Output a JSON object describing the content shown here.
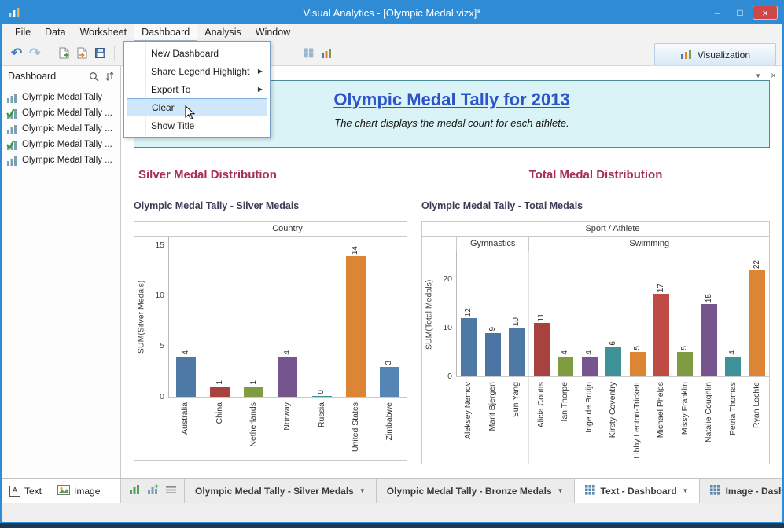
{
  "window": {
    "title": "Visual Analytics - [Olympic Medal.vizx]*",
    "controls": {
      "minimize": "–",
      "maximize": "□",
      "close": "×"
    }
  },
  "menu_bar": {
    "items": [
      {
        "label": "File",
        "open": false
      },
      {
        "label": "Data",
        "open": false
      },
      {
        "label": "Worksheet",
        "open": false
      },
      {
        "label": "Dashboard",
        "open": true
      },
      {
        "label": "Analysis",
        "open": false
      },
      {
        "label": "Window",
        "open": false
      }
    ]
  },
  "dashboard_menu": {
    "items": [
      {
        "label": "New Dashboard",
        "submenu": false,
        "highlighted": false
      },
      {
        "label": "Share Legend Highlight",
        "submenu": true,
        "highlighted": false
      },
      {
        "label": "Export To",
        "submenu": true,
        "highlighted": false
      },
      {
        "label": "Clear",
        "submenu": false,
        "highlighted": true
      },
      {
        "label": "Show Title",
        "submenu": false,
        "highlighted": false
      }
    ]
  },
  "toolbar": {
    "visualization_label": "Visualization"
  },
  "panel": {
    "menu_glyph": "▼",
    "close_glyph": "×"
  },
  "glyphs": {
    "undo": "↶",
    "redo": "↷",
    "small_chevron": "▾",
    "dropdown_chevron": "▼",
    "submenu_arrow": "▶"
  },
  "sidebar": {
    "header": "Dashboard",
    "items": [
      {
        "label": "Olympic Medal Tally",
        "checked": false
      },
      {
        "label": "Olympic Medal Tally ...",
        "checked": true
      },
      {
        "label": "Olympic Medal Tally ...",
        "checked": false
      },
      {
        "label": "Olympic Medal Tally ...",
        "checked": true
      },
      {
        "label": "Olympic Medal Tally ...",
        "checked": false
      }
    ],
    "footer": {
      "text_label": "Text",
      "text_icon_glyph": "A",
      "image_label": "Image"
    }
  },
  "banner": {
    "title": "Olympic Medal Tally for 2013",
    "subtitle": "The chart displays the medal count for each athlete."
  },
  "chart_data": [
    {
      "type": "bar",
      "section_heading": "Silver Medal Distribution",
      "title": "Olympic Medal Tally - Silver Medals",
      "column_header": "Country",
      "ylabel": "SUM(Silver Medals)",
      "yticks": [
        0,
        5,
        10,
        15
      ],
      "ylim": [
        0,
        16
      ],
      "grid": false,
      "categories": [
        "Australia",
        "China",
        "Netherlands",
        "Norway",
        "Russia",
        "United States",
        "Zimbabwe"
      ],
      "values": [
        4,
        1,
        1,
        4,
        0,
        14,
        3
      ],
      "colors": [
        "#4e79a7",
        "#a8423e",
        "#7f9c43",
        "#76558e",
        "#3d9397",
        "#db8535",
        "#5585b5"
      ],
      "groups": []
    },
    {
      "type": "bar",
      "section_heading": "Total Medal Distribution",
      "title": "Olympic Medal Tally - Total Medals",
      "column_header": "Sport / Athlete",
      "ylabel": "SUM(Total Medals)",
      "yticks": [
        0,
        10,
        20
      ],
      "ylim": [
        0,
        26
      ],
      "grid": false,
      "groups": [
        {
          "label": "Gymnastics",
          "span": 3
        },
        {
          "label": "Swimming",
          "span": 10
        }
      ],
      "categories": [
        "Aleksey Nemov",
        "Marit Bjergen",
        "Sun Yang",
        "Alicia Coutts",
        "Ian Thorpe",
        "Inge de Bruijn",
        "Kirsty Coventry",
        "Libby Lenton-Trickett",
        "Michael Phelps",
        "Missy Franklin",
        "Natalie Coughlin",
        "Petria Thomas",
        "Ryan Lochte"
      ],
      "values": [
        12,
        9,
        10,
        11,
        4,
        4,
        6,
        5,
        17,
        5,
        15,
        4,
        22
      ],
      "colors": [
        "#4e79a7",
        "#4a75a4",
        "#4e79a7",
        "#a8423e",
        "#7f9c43",
        "#76558e",
        "#3d9397",
        "#db8535",
        "#bf4b44",
        "#7f9c43",
        "#76558e",
        "#3d9397",
        "#db8535"
      ]
    }
  ],
  "tab_bar": {
    "tabs": [
      {
        "label": "Olympic Medal Tally - Silver Medals",
        "active": false,
        "dropdown": true,
        "icon": false
      },
      {
        "label": "Olympic Medal Tally - Bronze Medals",
        "active": false,
        "dropdown": true,
        "icon": false
      },
      {
        "label": "Text - Dashboard",
        "active": true,
        "dropdown": true,
        "icon": true
      },
      {
        "label": "Image - Dashboard",
        "active": false,
        "dropdown": false,
        "icon": true
      }
    ],
    "nav": {
      "prev": "◄",
      "next": "►"
    }
  }
}
